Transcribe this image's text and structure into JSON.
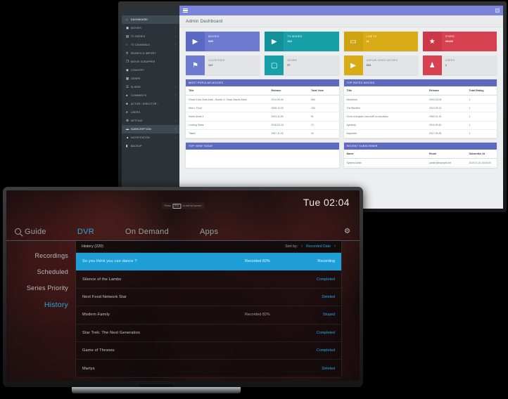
{
  "monitor": {
    "window_title": "Admin Dashboard",
    "topbar": {
      "menu_icon": "hamburger-icon",
      "right_icon": "panel-icon"
    },
    "sidebar": {
      "items": [
        {
          "label": "Dashboard",
          "icon": "home-icon",
          "caret": "",
          "active": true
        },
        {
          "label": "Movies",
          "icon": "film-icon",
          "caret": "›",
          "active": false
        },
        {
          "label": "TV Series",
          "icon": "tv-series-icon",
          "caret": "›",
          "active": false
        },
        {
          "label": "TV Channels",
          "icon": "tv-channel-icon",
          "caret": "›",
          "active": false
        },
        {
          "label": "Search & Import",
          "icon": "search-icon",
          "caret": "",
          "active": false
        },
        {
          "label": "Movie Scrapper",
          "icon": "copy-icon",
          "caret": "",
          "active": false
        },
        {
          "label": "Country",
          "icon": "globe-icon",
          "caret": "",
          "active": false
        },
        {
          "label": "Genre",
          "icon": "grid-icon",
          "caret": "",
          "active": false
        },
        {
          "label": "Slider",
          "icon": "slider-icon",
          "caret": "›",
          "active": false
        },
        {
          "label": "Comments",
          "icon": "comment-icon",
          "caret": "›",
          "active": false
        },
        {
          "label": "Actor / Director...",
          "icon": "actor-icon",
          "caret": "",
          "active": false
        },
        {
          "label": "Users",
          "icon": "user-icon",
          "caret": "",
          "active": false
        },
        {
          "label": "Setting",
          "icon": "gear-icon",
          "caret": "›",
          "active": false
        },
        {
          "label": "Subscription",
          "icon": "card-icon",
          "caret": "›",
          "active": true
        },
        {
          "label": "Notification",
          "icon": "bell-icon",
          "caret": "›",
          "active": false
        },
        {
          "label": "Backup",
          "icon": "archive-icon",
          "caret": "",
          "active": false
        }
      ]
    },
    "cards": [
      {
        "label": "Movies",
        "value": "545",
        "icon": "video-camera-icon",
        "style": "solid",
        "color": "#6c7bd0",
        "icon_color": "#5a6ac4"
      },
      {
        "label": "TV-Series",
        "value": "113",
        "icon": "video-camera-icon",
        "style": "solid",
        "color": "#18a0a8",
        "icon_color": "#12919a"
      },
      {
        "label": "Live TV",
        "value": "11",
        "icon": "monitor-icon",
        "style": "solid",
        "color": "#d9ab16",
        "icon_color": "#cfa210"
      },
      {
        "label": "Stars",
        "value": "40430",
        "icon": "star-icon",
        "style": "solid",
        "color": "#d8414f",
        "icon_color": "#cd3847"
      },
      {
        "label": "Countries",
        "value": "147",
        "icon": "flag-icon",
        "style": "light",
        "color": "#e2e4e6",
        "icon_color": "#6c7bd0"
      },
      {
        "label": "Genre",
        "value": "57",
        "icon": "box-icon",
        "style": "light",
        "color": "#e2e4e6",
        "icon_color": "#18a0a8"
      },
      {
        "label": "Unpublished Movies",
        "value": "804",
        "icon": "video-camera-icon",
        "style": "light",
        "color": "#e2e4e6",
        "icon_color": "#d9ab16"
      },
      {
        "label": "Users",
        "value": "1",
        "icon": "users-icon",
        "style": "light",
        "color": "#e2e4e6",
        "icon_color": "#d8414f"
      }
    ],
    "panels": {
      "most_popular": {
        "title": "Most Popular Movies",
        "columns": [
          "Title",
          "Release",
          "Total View"
        ],
        "rows": [
          [
            "Ghost in the Shell Arise - Border 4: Ghost Stands Alone",
            "2014-09-06",
            "566"
          ],
          [
            "Man v. Food",
            "2008-12-03",
            "156"
          ],
          [
            "Home Alone 4",
            "2003-11-26",
            "91"
          ],
          [
            "Looking Glass",
            "2018-02-16",
            "72"
          ],
          [
            "Titanic",
            "1997-11-18",
            "44"
          ]
        ]
      },
      "top_rated": {
        "title": "Top Rated Movies",
        "columns": [
          "Title",
          "Release",
          "Total Rating"
        ],
        "rows": [
          [
            "Bloodshot",
            "2020-03-05",
            "1"
          ],
          [
            "The Blacklist",
            "2013-09-23",
            "1"
          ],
          [
            "Onna ni tsuyoku naru kuffi no kazukazu",
            "1963-01-15",
            "1"
          ],
          [
            "Aynabaji",
            "2016-09-30",
            "1"
          ],
          [
            "Baywatch",
            "2017-05-25",
            "1"
          ]
        ]
      },
      "top_view_today": {
        "title": "Top View Today"
      },
      "recent_subscriber": {
        "title": "Recent Subscriber",
        "columns": [
          "Name",
          "Email",
          "Subscribe At"
        ],
        "rows": [
          [
            "System Admin",
            "admin@example.net",
            "2019-01-01 00:00:00"
          ]
        ]
      }
    }
  },
  "tv": {
    "fullscreen_hint_prefix": "Press",
    "fullscreen_key": "F11",
    "fullscreen_hint_suffix": "to exit full screen",
    "clock": "Tue 02:04",
    "nav": [
      {
        "label": "Guide",
        "icon": "search-icon",
        "active": false
      },
      {
        "label": "DVR",
        "icon": "",
        "active": true
      },
      {
        "label": "On Demand",
        "icon": "",
        "active": false
      },
      {
        "label": "Apps",
        "icon": "",
        "active": false
      }
    ],
    "settings_icon": "gear-icon",
    "dvr_menu": [
      {
        "label": "Recordings",
        "active": false
      },
      {
        "label": "Scheduled",
        "active": false
      },
      {
        "label": "Series Priority",
        "active": false
      },
      {
        "label": "History",
        "active": true
      }
    ],
    "list_header": {
      "title": "History (220)",
      "sort_label": "Sort by:",
      "sort_value": "Recorded Date",
      "prev_icon": "chevron-left-icon",
      "next_icon": "chevron-right-icon"
    },
    "rows": [
      {
        "title": "So you think you can dance ?",
        "progress": "Recorded 82%",
        "status": "Recording",
        "selected": true
      },
      {
        "title": "Silence of the Lambs",
        "progress": "",
        "status": "Completed",
        "selected": false
      },
      {
        "title": "Next Food Network Star",
        "progress": "",
        "status": "Deleted",
        "selected": false
      },
      {
        "title": "Modern Family",
        "progress": "Recorded 82%",
        "status": "Stoped",
        "selected": false
      },
      {
        "title": "Star Trek: The Next Generation",
        "progress": "",
        "status": "Completed",
        "selected": false
      },
      {
        "title": "Game of Thrones",
        "progress": "",
        "status": "Completed",
        "selected": false
      },
      {
        "title": "Martys",
        "progress": "",
        "status": "Deleted",
        "selected": false
      }
    ],
    "accent_color": "#2aa7e0"
  }
}
